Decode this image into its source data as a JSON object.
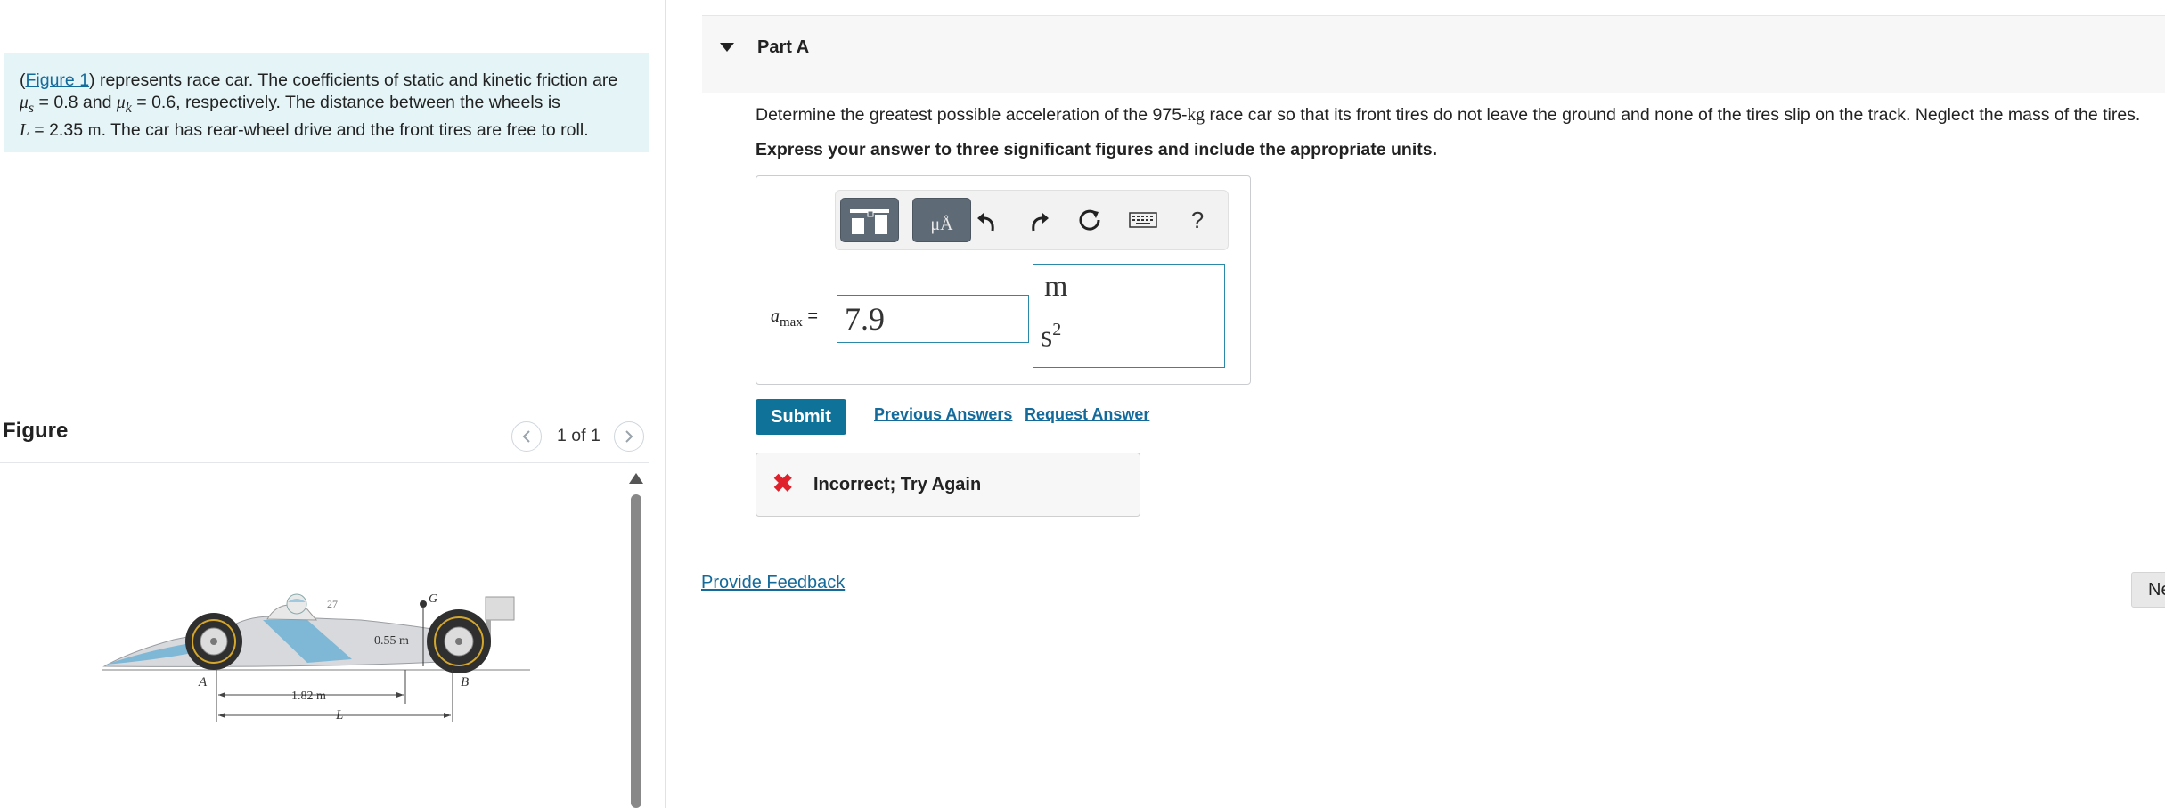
{
  "problem": {
    "figure_link": "Figure 1",
    "intro": ") represents race car. The coefficients of static and kinetic friction are",
    "mu_s_sym": "μ",
    "mu_s_sub": "s",
    "mu_s_val": " = 0.8 and ",
    "mu_k_sym": "μ",
    "mu_k_sub": "k",
    "mu_k_val": " = 0.6, respectively. The distance between the wheels is",
    "L_sym": "L",
    "L_val": " = 2.35 ",
    "L_unit": "m",
    "tail": ". The car has rear-wheel drive and the front tires are free to roll."
  },
  "figure_panel": {
    "title": "Figure",
    "counter": "1 of 1",
    "labels": {
      "point_a": "A",
      "point_b": "B",
      "point_g": "G",
      "car_number": "27",
      "height_dim": "0.55 m",
      "rear_to_g_dim": "1.82 m",
      "wheelbase": "L"
    }
  },
  "part": {
    "title": "Part A",
    "question_pre": "Determine the greatest possible acceleration of the 975-",
    "question_unit": "kg",
    "question_post": " race car so that its front tires do not leave the ground and none of the tires slip on the track. Neglect the mass of the tires.",
    "instruction": "Express your answer to three significant figures and include the appropriate units."
  },
  "answer": {
    "label_sym": "a",
    "label_sub": "max",
    "label_eq": " =",
    "value": "7.9",
    "unit_numerator": "m",
    "unit_denominator": "s",
    "unit_exponent": "2"
  },
  "toolbar": {
    "units_glyph": "μÅ",
    "help_label": "?",
    "icons": [
      "templates-icon",
      "units-icon",
      "undo-icon",
      "redo-icon",
      "reset-icon",
      "keyboard-icon",
      "help-icon"
    ]
  },
  "actions": {
    "submit_label": "Submit",
    "previous_answers_label": "Previous Answers",
    "request_answer_label": "Request Answer"
  },
  "feedback": {
    "icon": "✖",
    "text": "Incorrect; Try Again",
    "status_color": "#e0202a"
  },
  "footer": {
    "provide_feedback_label": "Provide Feedback",
    "next_label": "Ne"
  },
  "colors": {
    "link": "#146a9a",
    "submit_bg": "#0f7299",
    "problem_bg": "#e4f4f7",
    "input_border": "#2a89a8"
  }
}
